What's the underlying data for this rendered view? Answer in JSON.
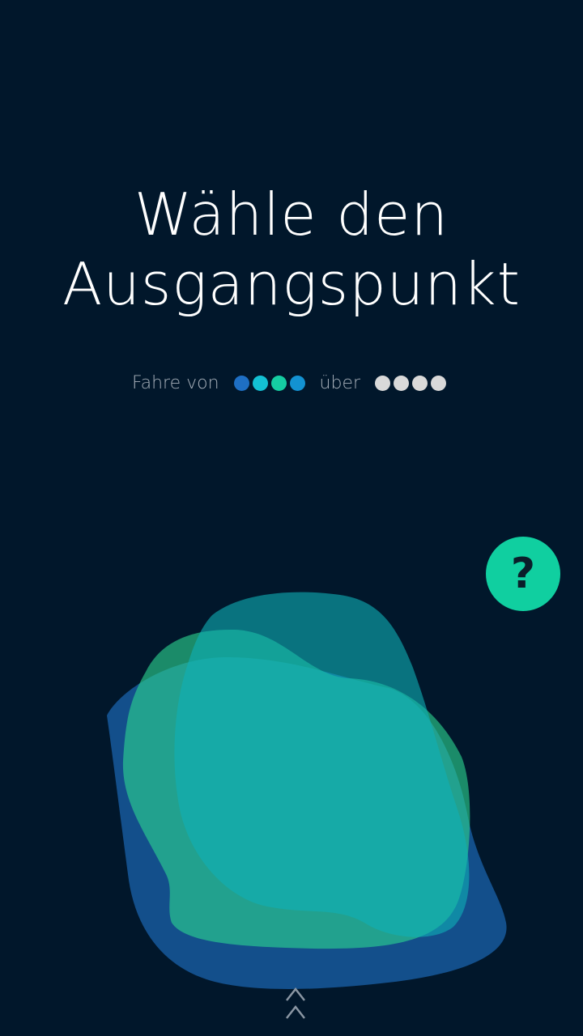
{
  "title": {
    "line1": "Wähle den",
    "line2": "Ausgangspunkt"
  },
  "route": {
    "from_label": "Fahre von",
    "via_label": "über",
    "from_dots": [
      "#1e6fc4",
      "#13c1d4",
      "#15cda2",
      "#1392d2"
    ],
    "via_dots": [
      "#d9d9d9",
      "#d9d9d9",
      "#d9d9d9",
      "#d9d9d9"
    ]
  },
  "help": {
    "label": "?",
    "color": "#10cfa0"
  },
  "colors": {
    "background": "#01172b",
    "blob_blue": "#1b65b0",
    "blob_teal": "#0fb0b8",
    "blob_green": "#2bd48f"
  },
  "icons": {
    "swipe_up": "double-chevron-up-icon"
  }
}
